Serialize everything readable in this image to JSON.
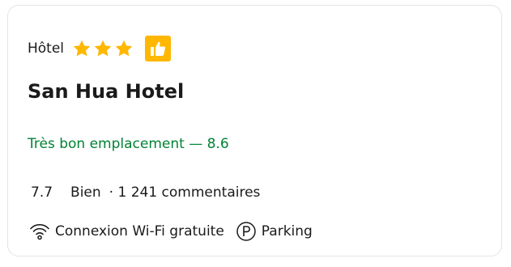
{
  "card": {
    "type_label": "Hôtel",
    "stars": 3,
    "badge_icon": "thumbs-up-icon",
    "name": "San Hua Hotel",
    "location_text": "Très bon emplacement — 8.6",
    "rating": {
      "score": "7.7",
      "word": "Bien",
      "reviews": "· 1 241 commentaires"
    },
    "amenities": [
      {
        "icon": "wifi-icon",
        "label": "Connexion Wi-Fi gratuite"
      },
      {
        "icon": "parking-icon",
        "label": "Parking"
      }
    ]
  },
  "colors": {
    "star": "#ffb700",
    "badge": "#ffb700",
    "location": "#008234",
    "border": "#e4e4e4"
  }
}
